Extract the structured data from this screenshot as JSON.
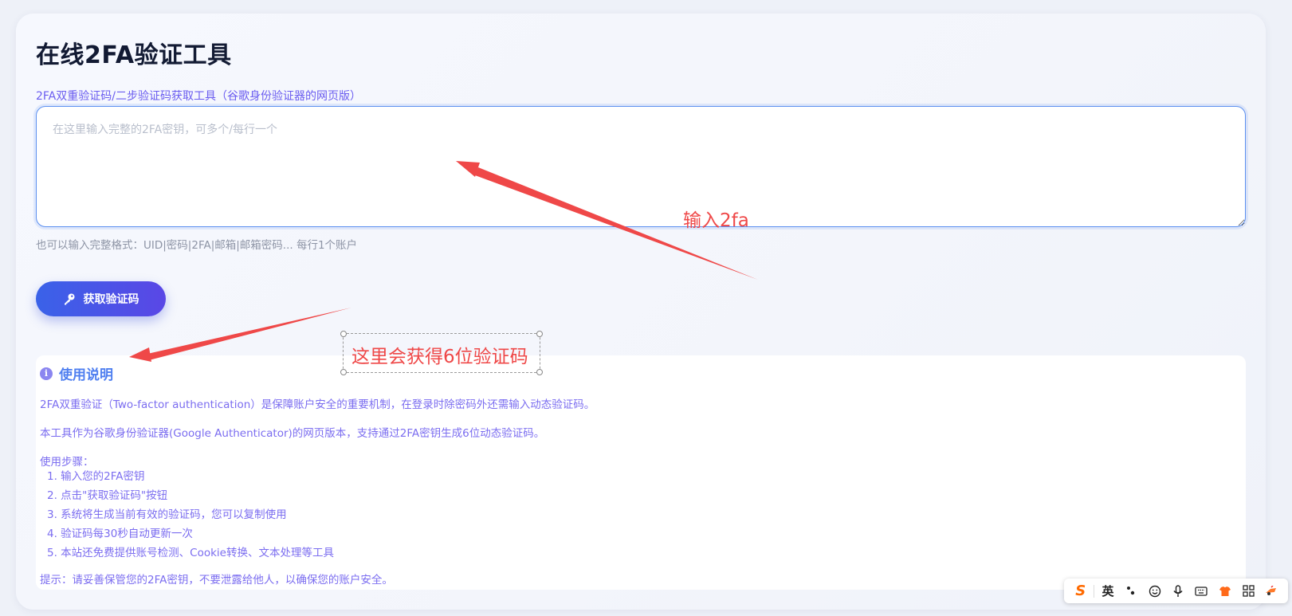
{
  "page": {
    "title": "在线2FA验证工具"
  },
  "form": {
    "label": "2FA双重验证码/二步验证码获取工具（谷歌身份验证器的网页版）",
    "textarea_placeholder": "在这里输入完整的2FA密钥，可多个/每行一个",
    "textarea_value": "",
    "hint": "也可以输入完整格式：UID|密码|2FA|邮箱|邮箱密码... 每行1个账户",
    "submit_label": "获取验证码"
  },
  "usage": {
    "title": "使用说明",
    "intro_1": "2FA双重验证（Two-factor authentication）是保障账户安全的重要机制，在登录时除密码外还需输入动态验证码。",
    "intro_2": "本工具作为谷歌身份验证器(Google Authenticator)的网页版本，支持通过2FA密钥生成6位动态验证码。",
    "steps_title": "使用步骤：",
    "steps": [
      "1. 输入您的2FA密钥",
      "2. 点击\"获取验证码\"按钮",
      "3. 系统将生成当前有效的验证码，您可以复制使用",
      "4. 验证码每30秒自动更新一次",
      "5. 本站还免费提供账号检测、Cookie转换、文本处理等工具"
    ],
    "tip": "提示：请妥善保管您的2FA密钥，不要泄露给他人，以确保您的账户安全。"
  },
  "annotations": {
    "arrow_color": "#ef4848",
    "label_input": "输入2fa",
    "label_result": "这里会获得6位验证码"
  },
  "ime_toolbar": {
    "logo": "S",
    "lang": "英",
    "items": [
      "punctuation-icon",
      "emoji-icon",
      "microphone-icon",
      "keyboard-icon",
      "skin-icon",
      "apps-grid-icon",
      "tools-icon"
    ]
  },
  "colors": {
    "title": "#121a33",
    "accent_purple": "#6a5cf0",
    "accent_blue": "#4f7ff0",
    "button_gradient_start": "#3a62e8",
    "button_gradient_end": "#5a47e6",
    "annotation_red": "#ef4848"
  }
}
